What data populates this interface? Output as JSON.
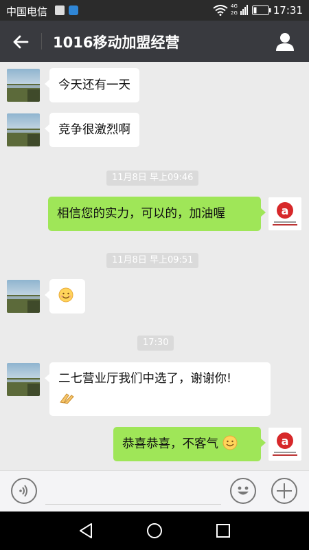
{
  "status_bar": {
    "carrier": "中国电信",
    "network": [
      "4G",
      "2G"
    ],
    "time": "17:31"
  },
  "header": {
    "title": "1016移动加盟经营"
  },
  "messages": {
    "m1": {
      "text": "今天还有一天"
    },
    "m2": {
      "text": "竞争很激烈啊"
    },
    "t1": {
      "text": "11月8日 早上09:46"
    },
    "m3": {
      "text": "相信您的实力，可以的，加油喔"
    },
    "t2": {
      "text": "11月8日 早上09:51"
    },
    "t3": {
      "text": "17:30"
    },
    "m5": {
      "text": "二七营业厅我们中选了，谢谢你!"
    },
    "m6": {
      "text": "恭喜恭喜，不客气"
    }
  },
  "colors": {
    "header_bg": "#393a3f",
    "chat_bg": "#ebebeb",
    "sent_bubble": "#9fe658",
    "received_bubble": "#ffffff"
  }
}
